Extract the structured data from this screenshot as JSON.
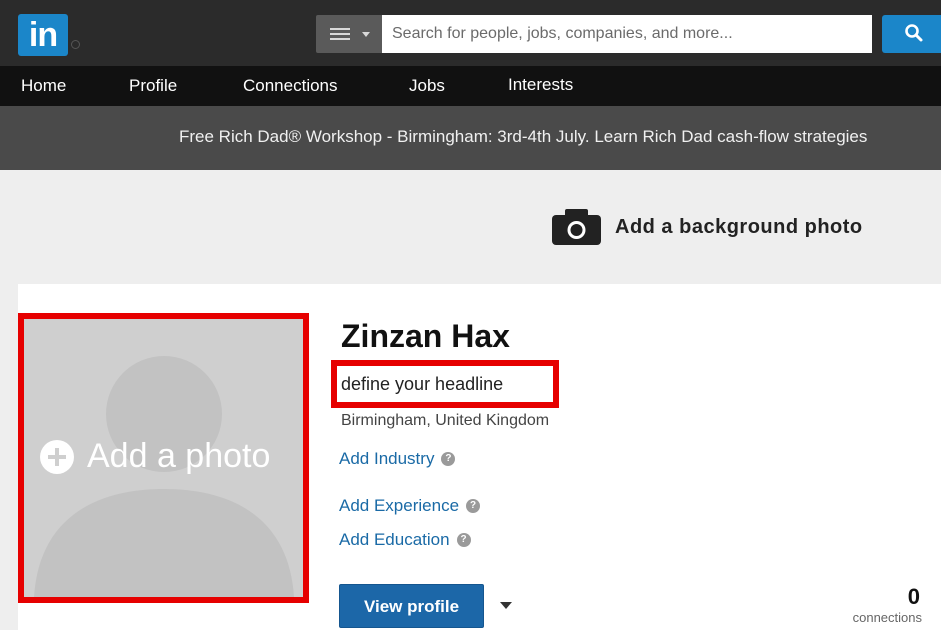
{
  "header": {
    "logo_text": "in",
    "search_placeholder": "Search for people, jobs, companies, and more...",
    "search_icon": "search-icon",
    "scope_icon": "list-icon",
    "brand_color": "#1b86c9"
  },
  "nav": {
    "items": [
      {
        "label": "Home"
      },
      {
        "label": "Profile"
      },
      {
        "label": "Connections"
      },
      {
        "label": "Jobs"
      },
      {
        "label": "Interests"
      }
    ]
  },
  "promo": {
    "text": "Free Rich Dad® Workshop - Birmingham: 3rd-4th July. Learn Rich Dad cash-flow strategies"
  },
  "background_photo": {
    "icon": "camera-icon",
    "label": "Add a background photo"
  },
  "profile": {
    "add_photo_label": "Add a photo",
    "name": "Zinzan Hax",
    "headline": "define your headline",
    "location": "Birmingham, United Kingdom",
    "add_industry": "Add Industry",
    "add_experience": "Add Experience",
    "add_education": "Add Education",
    "help_glyph": "?",
    "view_profile": "View profile",
    "connections_count": "0",
    "connections_label": "connections",
    "highlight_color": "#e60000",
    "link_color": "#1a6aa6"
  }
}
